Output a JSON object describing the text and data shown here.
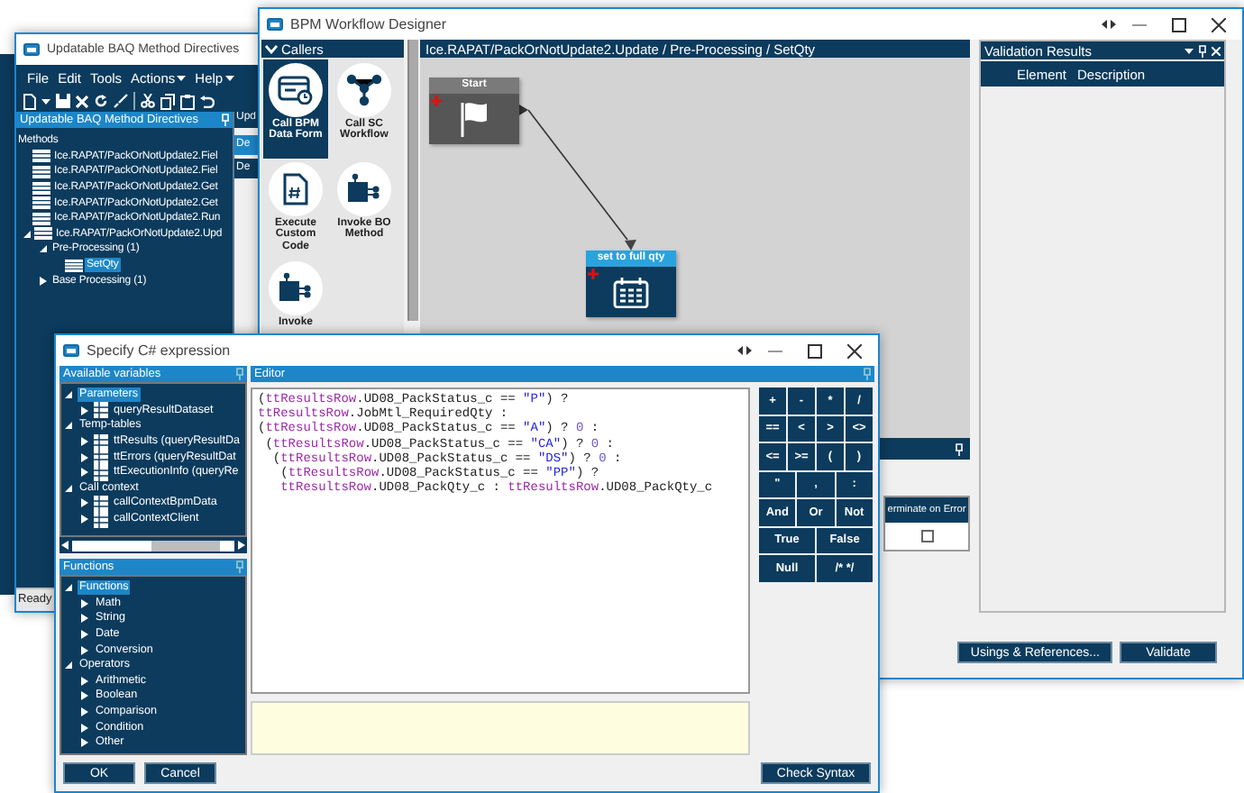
{
  "directives_window": {
    "title": "Updatable BAQ Method Directives",
    "menu": [
      {
        "label": "File",
        "dropdown": false
      },
      {
        "label": "Edit",
        "dropdown": false
      },
      {
        "label": "Tools",
        "dropdown": false
      },
      {
        "label": "Actions",
        "dropdown": true
      },
      {
        "label": "Help",
        "dropdown": true
      }
    ],
    "panel_title": "Updatable BAQ Method Directives",
    "tree_heading": "Methods",
    "tree": [
      {
        "label": "Ice.RAPAT/PackOrNotUpdate2.Fiel",
        "kind": "method",
        "selected": false
      },
      {
        "label": "Ice.RAPAT/PackOrNotUpdate2.Fiel",
        "kind": "method",
        "selected": false
      },
      {
        "label": "Ice.RAPAT/PackOrNotUpdate2.Get",
        "kind": "method",
        "selected": false
      },
      {
        "label": "Ice.RAPAT/PackOrNotUpdate2.Get",
        "kind": "method",
        "selected": false
      },
      {
        "label": "Ice.RAPAT/PackOrNotUpdate2.Run",
        "kind": "method",
        "selected": false
      },
      {
        "label": "Ice.RAPAT/PackOrNotUpdate2.Upd",
        "kind": "method",
        "expanded": true,
        "selected": false,
        "children": [
          {
            "label": "Pre-Processing (1)",
            "expanded": true,
            "selected": false,
            "children": [
              {
                "label": "SetQty",
                "kind": "directive",
                "selected": true
              }
            ]
          },
          {
            "label": "Base Processing (1)",
            "expanded": false,
            "selected": false
          }
        ]
      }
    ],
    "side_panel": {
      "title": "Upd",
      "tab": "De",
      "row": "De"
    },
    "status_bar": "Ready"
  },
  "designer_window": {
    "title": "BPM Workflow Designer",
    "palette": {
      "title": "Callers",
      "items": [
        {
          "label": "Call BPM Data Form",
          "kind": "form",
          "selected": true
        },
        {
          "label": "Call SC Workflow",
          "kind": "network",
          "selected": false
        },
        {
          "label": "Execute Custom Code",
          "kind": "code",
          "selected": false
        },
        {
          "label": "Invoke BO Method",
          "kind": "module",
          "selected": false
        },
        {
          "label": "Invoke",
          "kind": "module",
          "selected": false
        }
      ]
    },
    "breadcrumb": "Ice.RAPAT/PackOrNotUpdate2.Update / Pre-Processing / SetQty",
    "nodes": [
      {
        "kind": "start",
        "label": "Start"
      },
      {
        "kind": "form",
        "label": "set to full qty"
      }
    ],
    "validation": {
      "title": "Validation Results",
      "columns": [
        "Element",
        "Description"
      ]
    },
    "grid": {
      "column": "erminate on Error",
      "checked": false
    },
    "buttons": [
      "Usings & References...",
      "Validate"
    ]
  },
  "expression_window": {
    "title": "Specify C# expression",
    "variables": {
      "title": "Available variables",
      "tree": [
        {
          "label": "Parameters",
          "expanded": true,
          "selected": true,
          "children": [
            {
              "label": "queryResultDataset",
              "kind": "table",
              "expanded": false,
              "selected": false
            }
          ]
        },
        {
          "label": "Temp-tables",
          "expanded": true,
          "selected": false,
          "children": [
            {
              "label": "ttResults (queryResultDa",
              "kind": "table",
              "expanded": false,
              "selected": false
            },
            {
              "label": "ttErrors (queryResultDat",
              "kind": "table",
              "expanded": false,
              "selected": false
            },
            {
              "label": "ttExecutionInfo (queryRe",
              "kind": "table",
              "expanded": false,
              "selected": false
            }
          ]
        },
        {
          "label": "Call context",
          "expanded": true,
          "selected": false,
          "children": [
            {
              "label": "callContextBpmData",
              "kind": "table",
              "expanded": false,
              "selected": false
            },
            {
              "label": "callContextClient",
              "kind": "table",
              "expanded": false,
              "selected": false
            }
          ]
        }
      ]
    },
    "functions": {
      "title": "Functions",
      "tree": [
        {
          "label": "Functions",
          "expanded": true,
          "selected": true,
          "children": [
            {
              "label": "Math",
              "expanded": false,
              "selected": false
            },
            {
              "label": "String",
              "expanded": false,
              "selected": false
            },
            {
              "label": "Date",
              "expanded": false,
              "selected": false
            },
            {
              "label": "Conversion",
              "expanded": false,
              "selected": false
            }
          ]
        },
        {
          "label": "Operators",
          "expanded": true,
          "selected": false,
          "children": [
            {
              "label": "Arithmetic",
              "expanded": false,
              "selected": false
            },
            {
              "label": "Boolean",
              "expanded": false,
              "selected": false
            },
            {
              "label": "Comparison",
              "expanded": false,
              "selected": false
            },
            {
              "label": "Condition",
              "expanded": false,
              "selected": false
            },
            {
              "label": "Other",
              "expanded": false,
              "selected": false
            }
          ]
        }
      ]
    },
    "editor": {
      "title": "Editor",
      "lines": [
        [
          {
            "kind": "plain",
            "text": "("
          },
          {
            "kind": "field",
            "text": "ttResultsRow"
          },
          {
            "kind": "plain",
            "text": ".UD08_PackStatus_c == "
          },
          {
            "kind": "string",
            "text": "\"P\""
          },
          {
            "kind": "plain",
            "text": ") ?"
          }
        ],
        [
          {
            "kind": "field",
            "text": "ttResultsRow"
          },
          {
            "kind": "plain",
            "text": ".JobMtl_RequiredQty :"
          }
        ],
        [
          {
            "kind": "plain",
            "text": "("
          },
          {
            "kind": "field",
            "text": "ttResultsRow"
          },
          {
            "kind": "plain",
            "text": ".UD08_PackStatus_c == "
          },
          {
            "kind": "string",
            "text": "\"A\""
          },
          {
            "kind": "plain",
            "text": ") ? "
          },
          {
            "kind": "number",
            "text": "0"
          },
          {
            "kind": "plain",
            "text": " :"
          }
        ],
        [
          {
            "kind": "plain",
            "text": " ("
          },
          {
            "kind": "field",
            "text": "ttResultsRow"
          },
          {
            "kind": "plain",
            "text": ".UD08_PackStatus_c == "
          },
          {
            "kind": "string",
            "text": "\"CA\""
          },
          {
            "kind": "plain",
            "text": ") ? "
          },
          {
            "kind": "number",
            "text": "0"
          },
          {
            "kind": "plain",
            "text": " :"
          }
        ],
        [
          {
            "kind": "plain",
            "text": "  ("
          },
          {
            "kind": "field",
            "text": "ttResultsRow"
          },
          {
            "kind": "plain",
            "text": ".UD08_PackStatus_c == "
          },
          {
            "kind": "string",
            "text": "\"DS\""
          },
          {
            "kind": "plain",
            "text": ") ? "
          },
          {
            "kind": "number",
            "text": "0"
          },
          {
            "kind": "plain",
            "text": " :"
          }
        ],
        [
          {
            "kind": "plain",
            "text": "   ("
          },
          {
            "kind": "field",
            "text": "ttResultsRow"
          },
          {
            "kind": "plain",
            "text": ".UD08_PackStatus_c == "
          },
          {
            "kind": "string",
            "text": "\"PP\""
          },
          {
            "kind": "plain",
            "text": ") ?"
          }
        ],
        [
          {
            "kind": "field",
            "text": "   ttResultsRow"
          },
          {
            "kind": "plain",
            "text": ".UD08_PackQty_c : "
          },
          {
            "kind": "field",
            "text": "ttResultsRow"
          },
          {
            "kind": "plain",
            "text": ".UD08_PackQty_c"
          }
        ]
      ]
    },
    "keypad": [
      [
        "+",
        "-",
        "*",
        "/"
      ],
      [
        "==",
        "<",
        ">",
        "<>"
      ],
      [
        "<=",
        ">=",
        "(",
        ")"
      ],
      [
        "\"",
        ",",
        ":"
      ],
      [
        "And",
        "Or",
        "Not"
      ],
      [
        "True",
        "False"
      ],
      [
        "Null",
        "/* */"
      ]
    ],
    "buttons": [
      "OK",
      "Cancel"
    ],
    "check_button": "Check Syntax"
  }
}
